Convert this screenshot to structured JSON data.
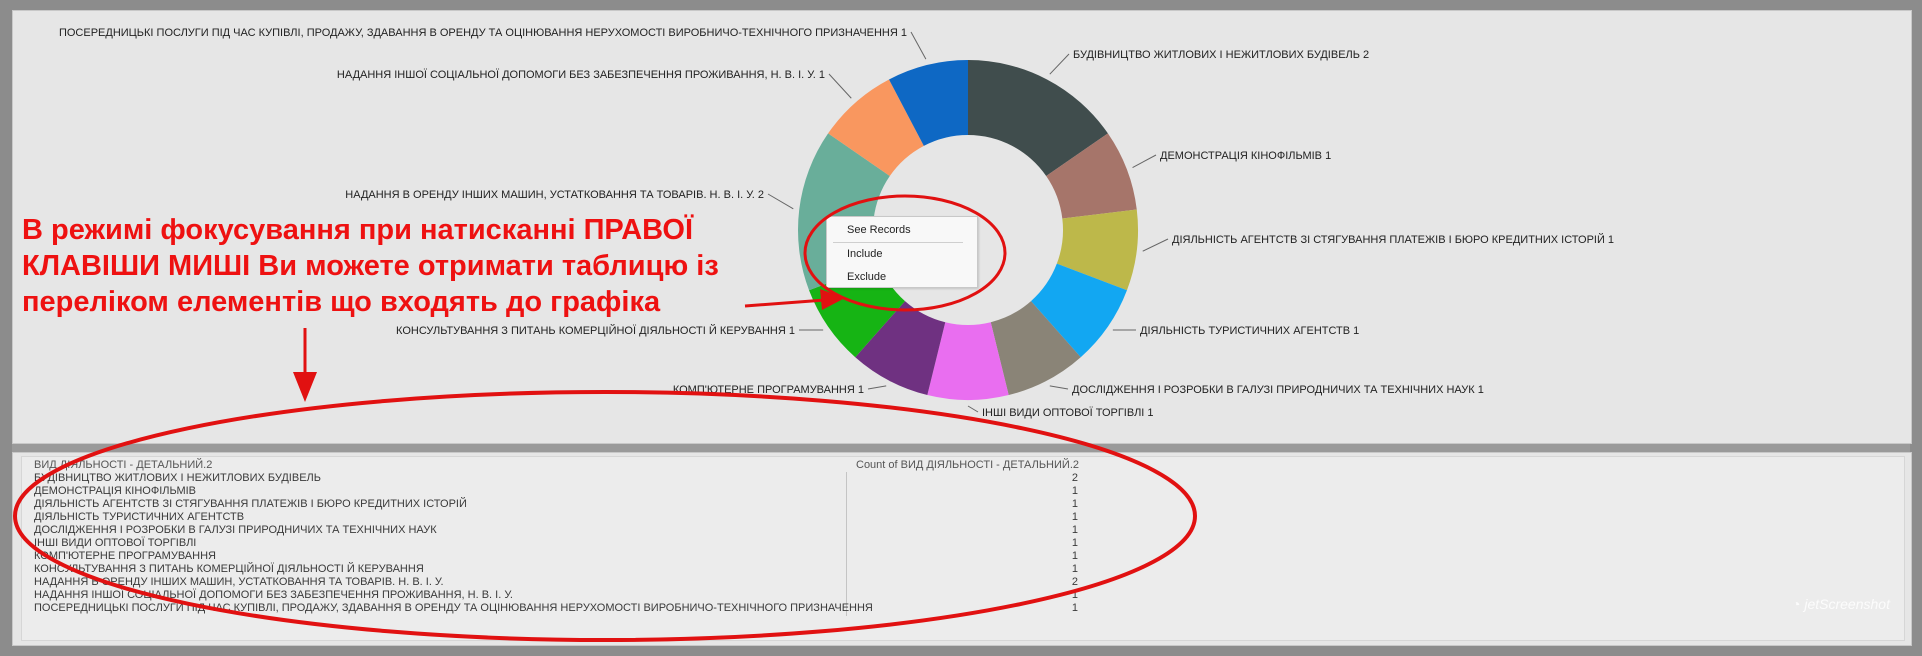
{
  "chart_data": {
    "type": "pie",
    "style": "donut",
    "categories": [
      "БУДІВНИЦТВО ЖИТЛОВИХ І НЕЖИТЛОВИХ БУДІВЕЛЬ",
      "ДЕМОНСТРАЦІЯ КІНОФІЛЬМІВ",
      "ДІЯЛЬНІСТЬ АГЕНТСТВ ЗІ СТЯГУВАННЯ ПЛАТЕЖІВ І БЮРО КРЕДИТНИХ ІСТОРІЙ",
      "ДІЯЛЬНІСТЬ ТУРИСТИЧНИХ АГЕНТСТВ",
      "ДОСЛІДЖЕННЯ І РОЗРОБКИ В ГАЛУЗІ ПРИРОДНИЧИХ ТА ТЕХНІЧНИХ НАУК",
      "ІНШІ ВИДИ ОПТОВОЇ ТОРГІВЛІ",
      "КОМП'ЮТЕРНЕ ПРОГРАМУВАННЯ",
      "КОНСУЛЬТУВАННЯ З ПИТАНЬ КОМЕРЦІЙНОЇ ДІЯЛЬНОСТІ Й КЕРУВАННЯ",
      "НАДАННЯ В ОРЕНДУ ІНШИХ МАШИН, УСТАТКОВАННЯ ТА ТОВАРІВ. Н. В. І. У.",
      "НАДАННЯ ІНШОЇ СОЦІАЛЬНОЇ ДОПОМОГИ БЕЗ ЗАБЕЗПЕЧЕННЯ ПРОЖИВАННЯ, Н. В. І. У.",
      "ПОСЕРЕДНИЦЬКІ ПОСЛУГИ ПІД ЧАС КУПІВЛІ, ПРОДАЖУ, ЗДАВАННЯ В ОРЕНДУ ТА ОЦІНЮВАННЯ НЕРУХОМОСТІ ВИРОБНИЧО-ТЕХНІЧНОГО ПРИЗНАЧЕННЯ"
    ],
    "values": [
      2,
      1,
      1,
      1,
      1,
      1,
      1,
      1,
      2,
      1,
      1
    ],
    "colors": [
      "#404d4d",
      "#a6756a",
      "#bdb84a",
      "#12a7f2",
      "#8a8477",
      "#e96ef0",
      "#6f3181",
      "#16b414",
      "#69ae9a",
      "#f9975f",
      "#0e68c4"
    ],
    "value_labels": [
      "2",
      "1",
      "1",
      "1",
      "1",
      "1",
      "1",
      "1",
      "2",
      "1",
      "1"
    ]
  },
  "context_menu": {
    "items": [
      "See Records",
      "Include",
      "Exclude"
    ]
  },
  "annotation": {
    "line1": "В режимі фокусування при натисканні ПРАВОЇ",
    "line2": "КЛАВІШИ МИШІ Ви можете отримати таблицю із",
    "line3": "переліком елементів що входять до графіка",
    "color": "#e11111"
  },
  "table": {
    "col1_header": "ВИД ДІЯЛЬНОСТІ - ДЕТАЛЬНИЙ.2",
    "col2_header": "Count of ВИД ДІЯЛЬНОСТІ - ДЕТАЛЬНИЙ.2",
    "rows": [
      {
        "name": "БУДІВНИЦТВО ЖИТЛОВИХ І НЕЖИТЛОВИХ БУДІВЕЛЬ",
        "count": "2"
      },
      {
        "name": "ДЕМОНСТРАЦІЯ КІНОФІЛЬМІВ",
        "count": "1"
      },
      {
        "name": "ДІЯЛЬНІСТЬ АГЕНТСТВ ЗІ СТЯГУВАННЯ ПЛАТЕЖІВ І БЮРО КРЕДИТНИХ ІСТОРІЙ",
        "count": "1"
      },
      {
        "name": "ДІЯЛЬНІСТЬ ТУРИСТИЧНИХ АГЕНТСТВ",
        "count": "1"
      },
      {
        "name": "ДОСЛІДЖЕННЯ І РОЗРОБКИ В ГАЛУЗІ ПРИРОДНИЧИХ ТА ТЕХНІЧНИХ НАУК",
        "count": "1"
      },
      {
        "name": "ІНШІ ВИДИ ОПТОВОЇ ТОРГІВЛІ",
        "count": "1"
      },
      {
        "name": "КОМП'ЮТЕРНЕ ПРОГРАМУВАННЯ",
        "count": "1"
      },
      {
        "name": "КОНСУЛЬТУВАННЯ З ПИТАНЬ КОМЕРЦІЙНОЇ ДІЯЛЬНОСТІ Й КЕРУВАННЯ",
        "count": "1"
      },
      {
        "name": "НАДАННЯ В ОРЕНДУ ІНШИХ МАШИН, УСТАТКОВАННЯ ТА ТОВАРІВ. Н. В. І. У.",
        "count": "2"
      },
      {
        "name": "НАДАННЯ ІНШОЇ СОЦІАЛЬНОЇ ДОПОМОГИ БЕЗ ЗАБЕЗПЕЧЕННЯ ПРОЖИВАННЯ, Н. В. І. У.",
        "count": "1"
      },
      {
        "name": "ПОСЕРЕДНИЦЬКІ ПОСЛУГИ ПІД ЧАС КУПІВЛІ, ПРОДАЖУ, ЗДАВАННЯ В ОРЕНДУ ТА ОЦІНЮВАННЯ НЕРУХОМОСТІ ВИРОБНИЧО-ТЕХНІЧНОГО ПРИЗНАЧЕННЯ",
        "count": "1"
      }
    ]
  },
  "watermark": "jetScreenshot"
}
